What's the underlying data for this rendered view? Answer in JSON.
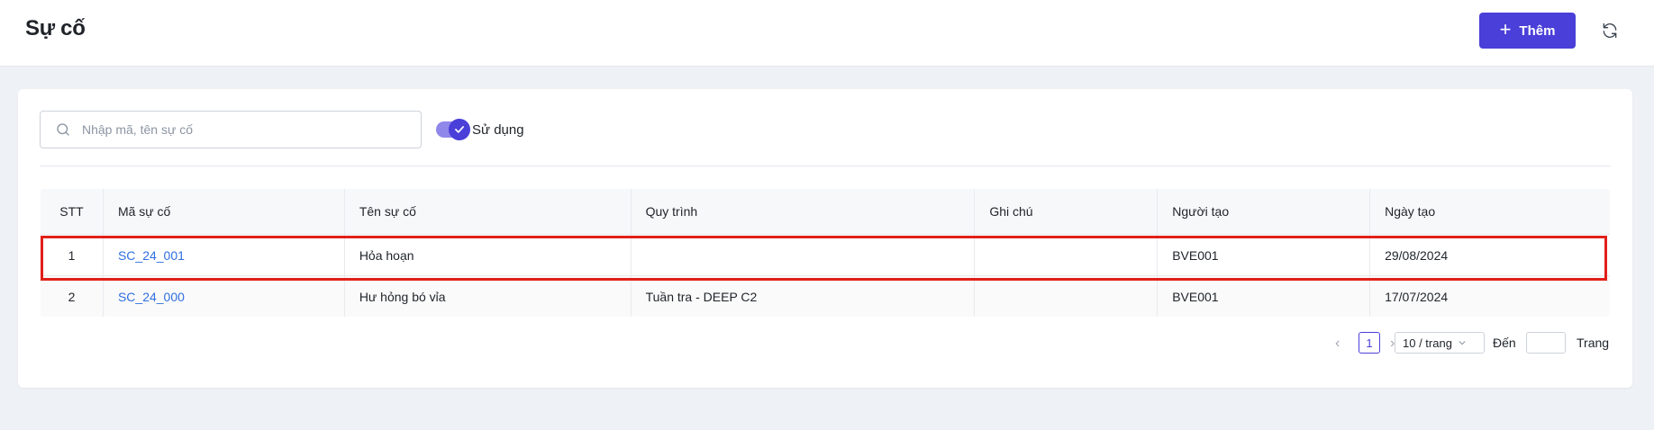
{
  "header": {
    "title": "Sự cố",
    "add_label": "Thêm",
    "accent_color": "#4a3fd8"
  },
  "toolbar": {
    "search_placeholder": "Nhập mã, tên sự cố",
    "search_value": "",
    "toggle_label": "Sử dụng",
    "toggle_on": true
  },
  "table": {
    "columns": [
      "STT",
      "Mã sự cố",
      "Tên sự cố",
      "Quy trình",
      "Ghi chú",
      "Người tạo",
      "Ngày tạo"
    ],
    "rows": [
      {
        "stt": "1",
        "code": "SC_24_001",
        "name": "Hỏa hoạn",
        "process": "",
        "note": "",
        "creator": "BVE001",
        "date": "29/08/2024"
      },
      {
        "stt": "2",
        "code": "SC_24_000",
        "name": "Hư hỏng bó vỉa",
        "process": "Tuần tra - DEEP C2",
        "note": "",
        "creator": "BVE001",
        "date": "17/07/2024"
      }
    ],
    "highlighted_row": 1,
    "highlight_color": "#e0201a",
    "link_color": "#2f6fe0"
  },
  "pagination": {
    "current_page": "1",
    "page_size": "10 / trang",
    "goto_label": "Đến",
    "goto_value": "",
    "page_label": "Trang"
  }
}
